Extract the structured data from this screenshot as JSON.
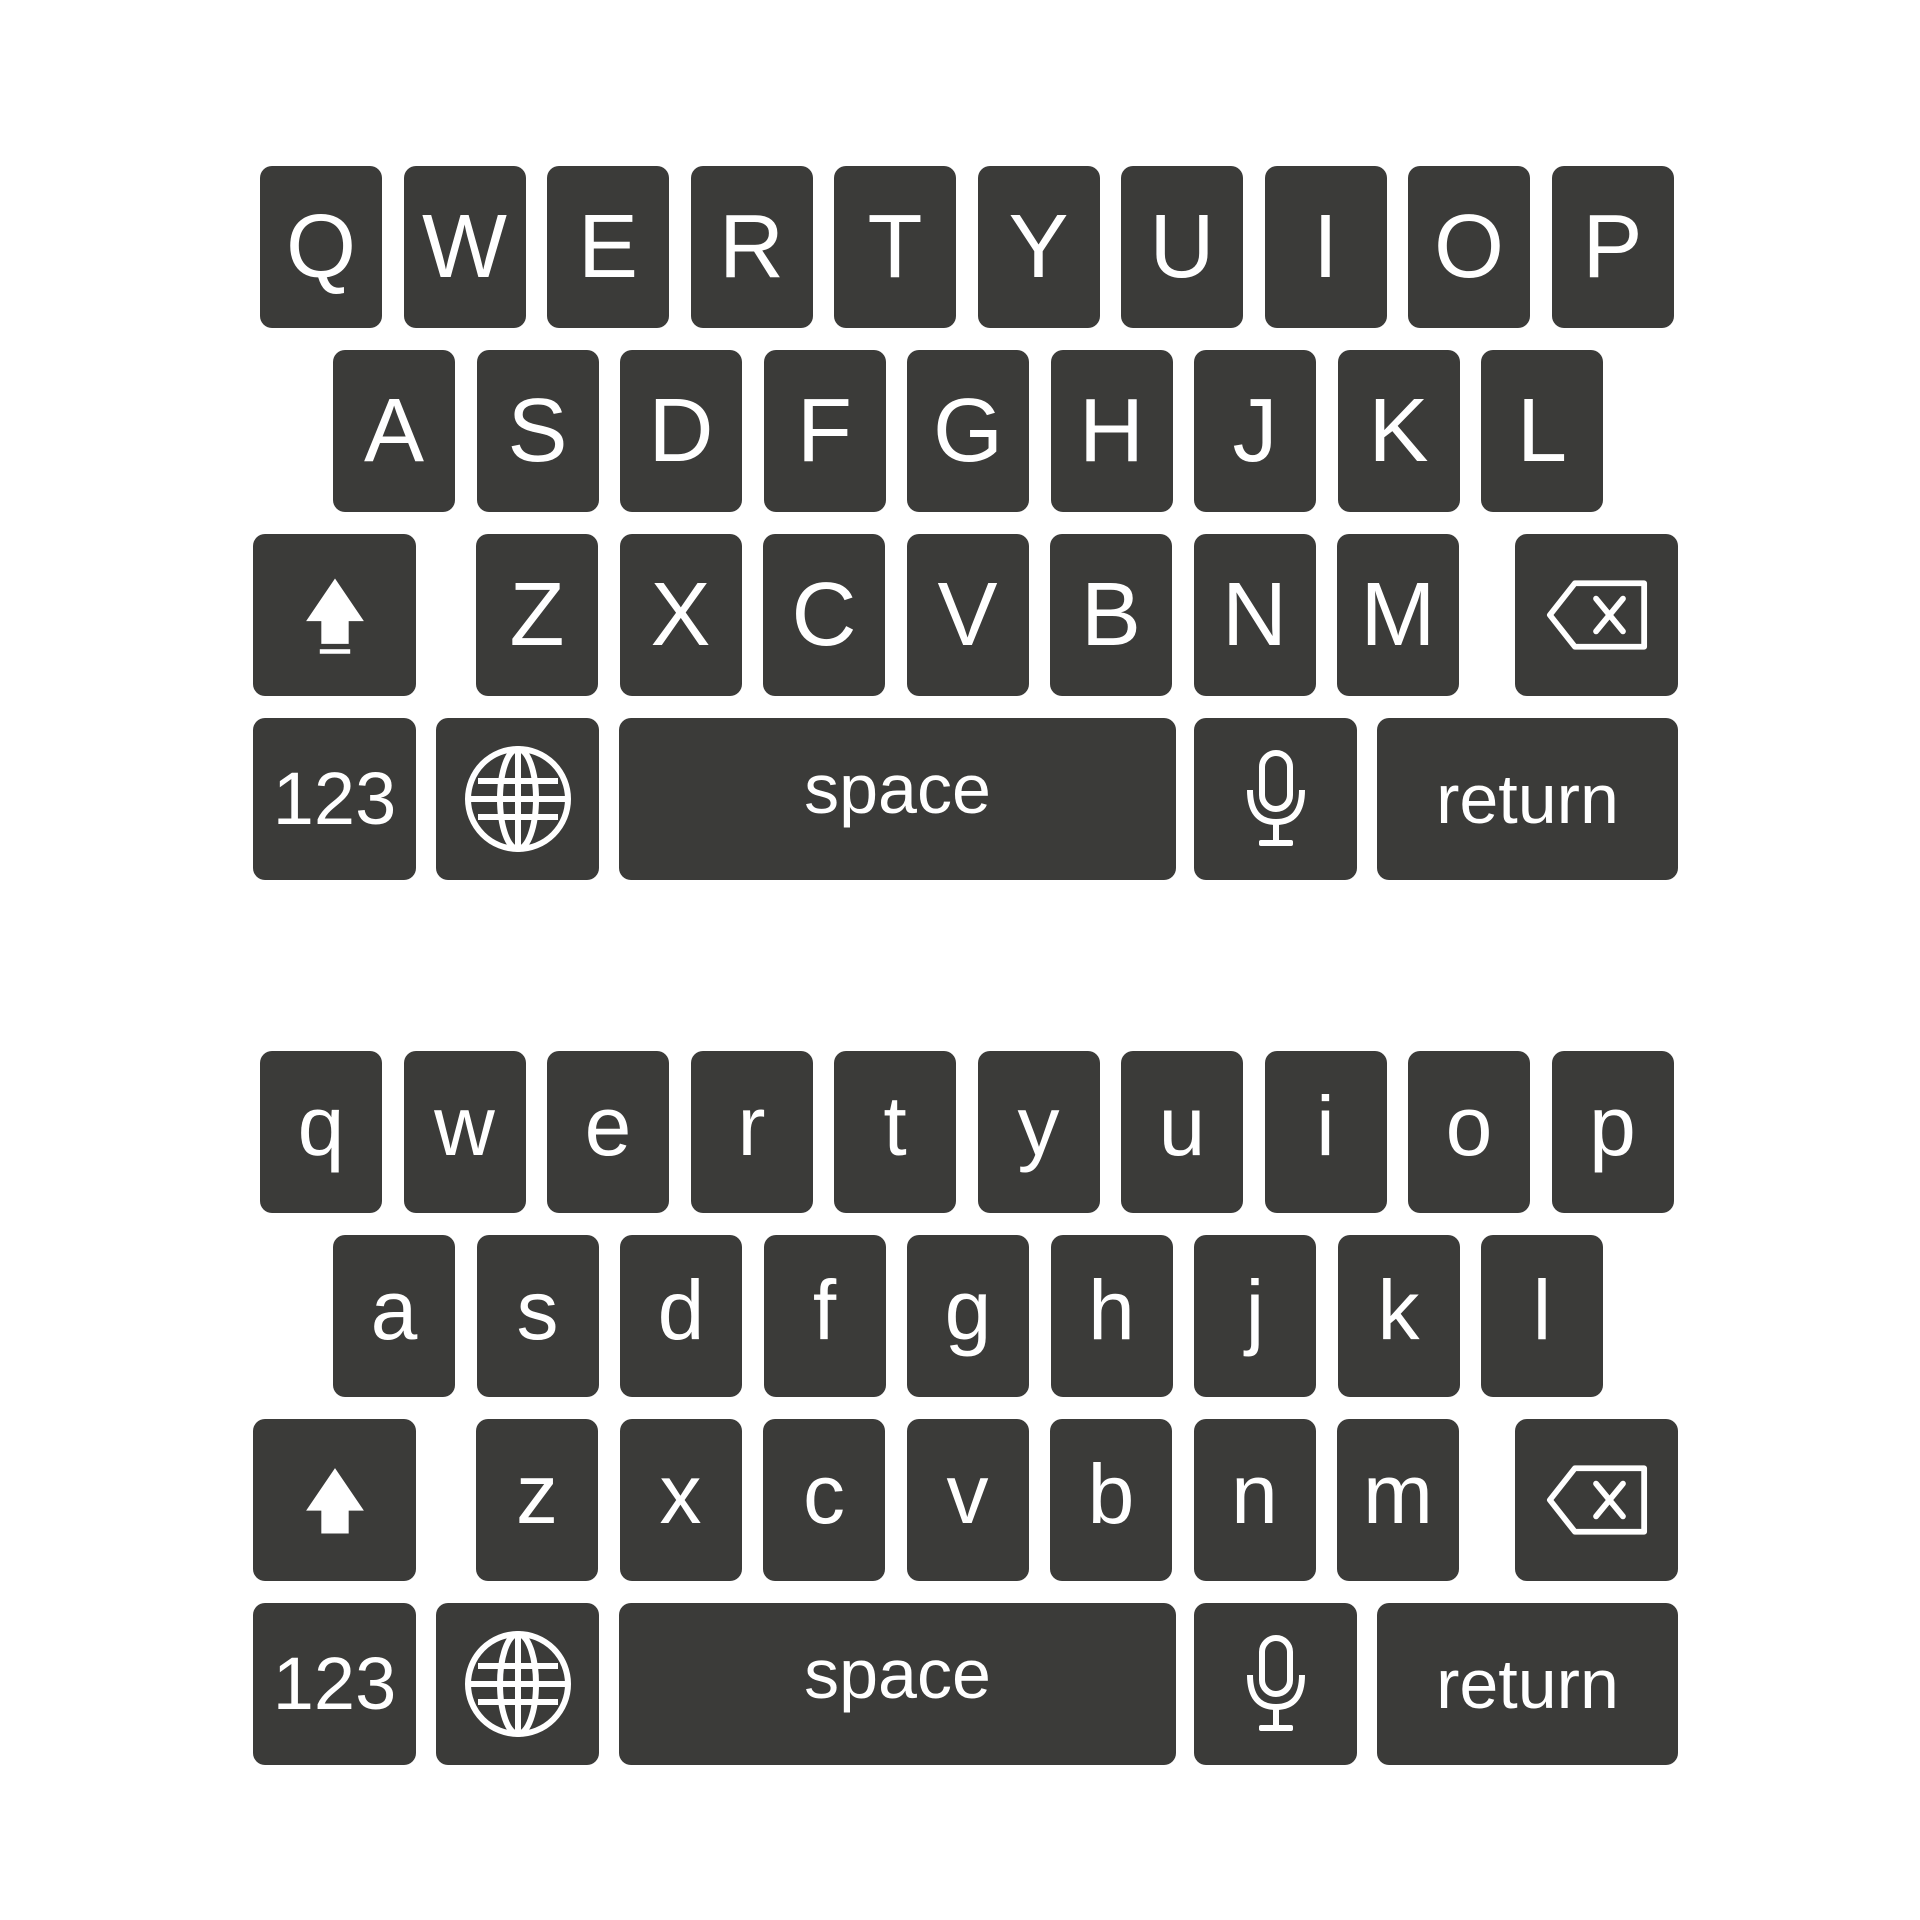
{
  "keyboards": [
    {
      "case": "upper",
      "rows": [
        [
          "Q",
          "W",
          "E",
          "R",
          "T",
          "Y",
          "U",
          "I",
          "O",
          "P"
        ],
        [
          "A",
          "S",
          "D",
          "F",
          "G",
          "H",
          "J",
          "K",
          "L"
        ],
        [
          "Z",
          "X",
          "C",
          "V",
          "B",
          "N",
          "M"
        ]
      ],
      "shift_icon": "shift-locked-icon",
      "backspace_icon": "backspace-icon",
      "numbers_label": "123",
      "globe_icon": "globe-icon",
      "space_label": "space",
      "mic_icon": "microphone-icon",
      "return_label": "return"
    },
    {
      "case": "lower",
      "rows": [
        [
          "q",
          "w",
          "e",
          "r",
          "t",
          "y",
          "u",
          "i",
          "o",
          "p"
        ],
        [
          "a",
          "s",
          "d",
          "f",
          "g",
          "h",
          "j",
          "k",
          "l"
        ],
        [
          "z",
          "x",
          "c",
          "v",
          "b",
          "n",
          "m"
        ]
      ],
      "shift_icon": "shift-icon",
      "backspace_icon": "backspace-icon",
      "numbers_label": "123",
      "globe_icon": "globe-icon",
      "space_label": "space",
      "mic_icon": "microphone-icon",
      "return_label": "return"
    }
  ],
  "colors": {
    "key_background": "#3b3b39",
    "key_foreground": "#ffffff",
    "page_background": "#ffffff"
  }
}
